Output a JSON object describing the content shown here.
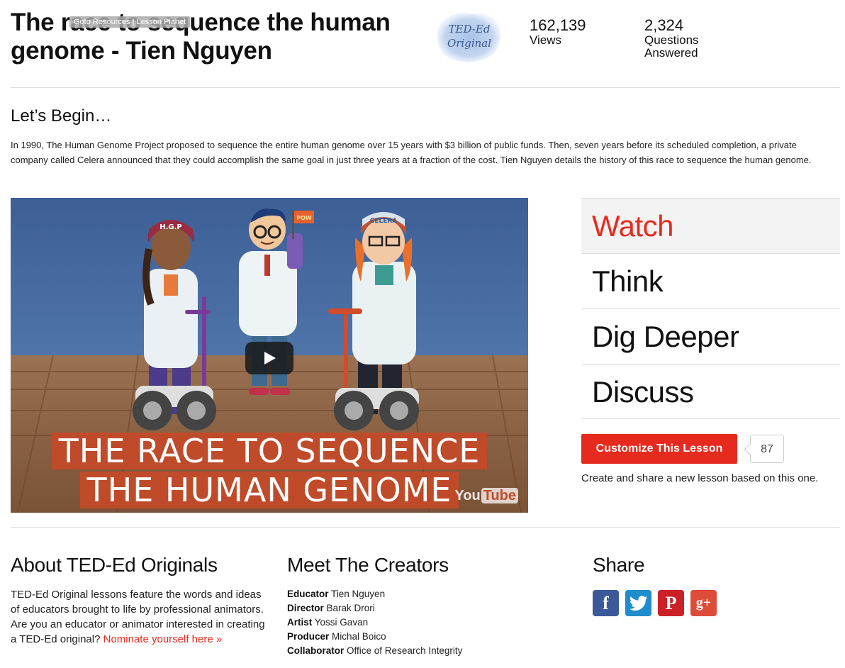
{
  "header": {
    "title": "The race to sequence the human genome - Tien Nguyen",
    "goto_badge": "Goto Resources | Lesson Planet",
    "badge_text": [
      "TED-Ed",
      "Original"
    ],
    "stats": [
      {
        "value": "162,139",
        "label": "Views"
      },
      {
        "value": "2,324",
        "label": "Questions Answered"
      }
    ]
  },
  "intro": {
    "heading": "Let’s Begin…",
    "text": "In 1990, The Human Genome Project proposed to sequence the entire human genome over 15 years with $3 billion of public funds. Then, seven years before its scheduled completion, a private company called Celera announced that they could accomplish the same goal in just three years at a fraction of the cost. Tien Nguyen details the history of this race to sequence the human genome."
  },
  "video": {
    "title_line1": "THE RACE TO SEQUENCE",
    "title_line2": "THE HUMAN GENOME",
    "helmet_left": "H.G.P",
    "helmet_right": "CELERA",
    "flag_text": "POW",
    "youtube_label": "You",
    "youtube_label2": "Tube"
  },
  "tabs": [
    {
      "label": "Watch",
      "active": true
    },
    {
      "label": "Think",
      "active": false
    },
    {
      "label": "Dig Deeper",
      "active": false
    },
    {
      "label": "Discuss",
      "active": false
    }
  ],
  "customize": {
    "button_label": "Customize This Lesson",
    "count": "87",
    "note": "Create and share a new lesson based on this one."
  },
  "about": {
    "heading": "About TED-Ed Originals",
    "text": "TED-Ed Original lessons feature the words and ideas of educators brought to life by professional animators. Are you an educator or animator interested in creating a TED-Ed original? ",
    "link": "Nominate yourself here »"
  },
  "creators": {
    "heading": "Meet The Creators",
    "list": [
      {
        "role": "Educator",
        "name": "Tien Nguyen"
      },
      {
        "role": "Director",
        "name": "Barak Drori"
      },
      {
        "role": "Artist",
        "name": "Yossi Gavan"
      },
      {
        "role": "Producer",
        "name": "Michal Boico"
      },
      {
        "role": "Collaborator",
        "name": "Office of Research Integrity"
      }
    ]
  },
  "share": {
    "heading": "Share",
    "icons": [
      {
        "name": "facebook-icon",
        "glyph": "f"
      },
      {
        "name": "twitter-icon",
        "glyph": ""
      },
      {
        "name": "pinterest-icon",
        "glyph": "P"
      },
      {
        "name": "google-plus-icon",
        "glyph": "g+"
      }
    ]
  },
  "colors": {
    "accent_red": "#e62b1e",
    "facebook": "#3b5998",
    "twitter": "#1f8ccb",
    "pinterest": "#cb2027",
    "google_plus": "#dd4b39"
  }
}
